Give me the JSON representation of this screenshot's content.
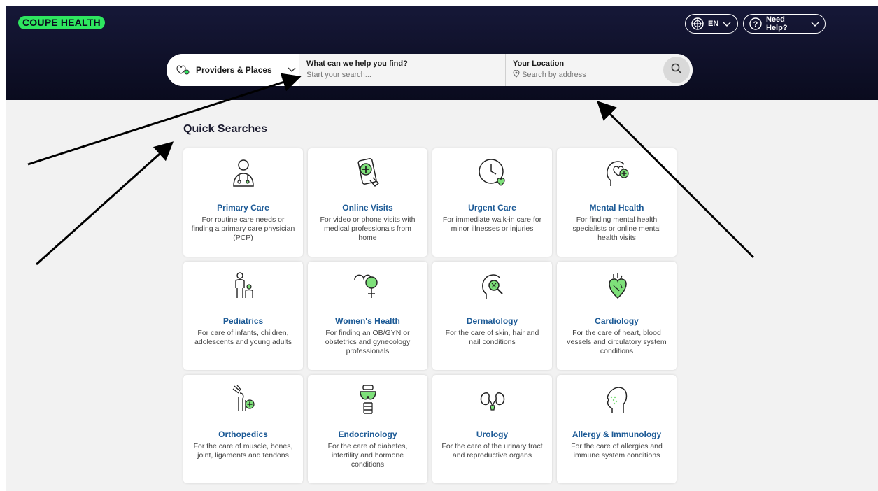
{
  "header": {
    "logo": "COUPE HEALTH",
    "language": "EN",
    "help": "Need Help?"
  },
  "search": {
    "type_label": "Providers & Places",
    "find_label": "What can we help you find?",
    "find_placeholder": "Start your search...",
    "location_label": "Your Location",
    "location_placeholder": "Search by address"
  },
  "quick_searches": {
    "title": "Quick Searches",
    "items": [
      {
        "label": "Primary Care",
        "desc": "For routine care needs or finding a primary care physician (PCP)",
        "icon": "doctor-icon"
      },
      {
        "label": "Online Visits",
        "desc": "For video or phone visits with medical professionals from home",
        "icon": "phone-medical-icon"
      },
      {
        "label": "Urgent Care",
        "desc": "For immediate walk-in care for minor illnesses or injuries",
        "icon": "clock-heart-icon"
      },
      {
        "label": "Mental Health",
        "desc": "For finding mental health specialists or online mental health visits",
        "icon": "head-plus-icon"
      },
      {
        "label": "Pediatrics",
        "desc": "For care of infants, children, adolescents and young adults",
        "icon": "parent-child-icon"
      },
      {
        "label": "Women's Health",
        "desc": "For finding an OB/GYN or obstetrics and gynecology professionals",
        "icon": "heart-female-icon"
      },
      {
        "label": "Dermatology",
        "desc": "For the care of skin, hair and nail conditions",
        "icon": "head-magnifier-icon"
      },
      {
        "label": "Cardiology",
        "desc": "For the care of heart, blood vessels and circulatory system conditions",
        "icon": "heart-organ-icon"
      },
      {
        "label": "Orthopedics",
        "desc": "For the care of muscle, bones, joint, ligaments and tendons",
        "icon": "joint-icon"
      },
      {
        "label": "Endocrinology",
        "desc": "For the care of diabetes, infertility and hormone conditions",
        "icon": "thyroid-icon"
      },
      {
        "label": "Urology",
        "desc": "For the care of the urinary tract and reproductive organs",
        "icon": "kidneys-icon"
      },
      {
        "label": "Allergy & Immunology",
        "desc": "For the care of allergies and immune system conditions",
        "icon": "head-sneeze-icon"
      }
    ]
  },
  "colors": {
    "header_bg": "#0f1029",
    "logo_green": "#2ee65f",
    "card_title": "#1c5a96",
    "icon_accent": "#7ee07a"
  }
}
